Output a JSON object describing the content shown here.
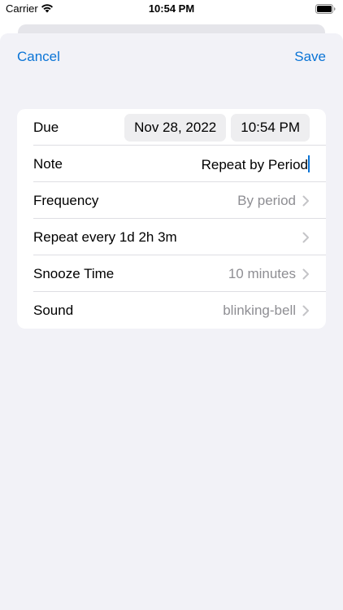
{
  "status_bar": {
    "carrier": "Carrier",
    "time": "10:54 PM"
  },
  "nav": {
    "cancel_label": "Cancel",
    "save_label": "Save"
  },
  "form": {
    "due": {
      "label": "Due",
      "date": "Nov 28, 2022",
      "time": "10:54 PM"
    },
    "note": {
      "label": "Note",
      "value": "Repeat by Period"
    },
    "frequency": {
      "label": "Frequency",
      "value": "By period"
    },
    "repeat": {
      "label": "Repeat every 1d 2h 3m"
    },
    "snooze": {
      "label": "Snooze Time",
      "value": "10 minutes"
    },
    "sound": {
      "label": "Sound",
      "value": "blinking-bell"
    }
  },
  "colors": {
    "accent": "#0a74d6",
    "background": "#f2f2f7",
    "secondary_text": "#8e8e93"
  }
}
